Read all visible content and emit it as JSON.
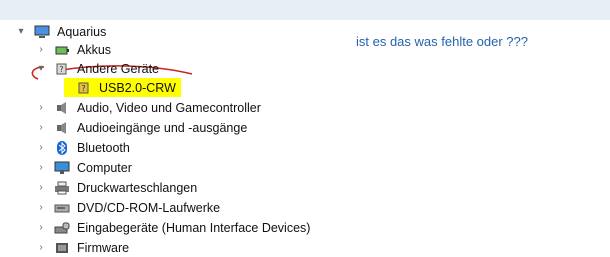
{
  "question": "ist es das was fehlte oder ???",
  "tree": {
    "root": "Aquarius",
    "items": [
      {
        "label": "Akkus",
        "icon": "battery-icon",
        "expanded": false
      },
      {
        "label": "Andere Geräte",
        "icon": "unknown-device-icon",
        "expanded": true
      },
      {
        "label": "USB2.0-CRW",
        "icon": "warning-device-icon",
        "child": true,
        "highlight": true
      },
      {
        "label": "Audio, Video und Gamecontroller",
        "icon": "speaker-icon",
        "expanded": false
      },
      {
        "label": "Audioeingänge und -ausgänge",
        "icon": "speaker-icon",
        "expanded": false
      },
      {
        "label": "Bluetooth",
        "icon": "bluetooth-icon",
        "expanded": false
      },
      {
        "label": "Computer",
        "icon": "monitor-icon",
        "expanded": false
      },
      {
        "label": "Druckwarteschlangen",
        "icon": "printer-icon",
        "expanded": false
      },
      {
        "label": "DVD/CD-ROM-Laufwerke",
        "icon": "disc-drive-icon",
        "expanded": false
      },
      {
        "label": "Eingabegeräte (Human Interface Devices)",
        "icon": "hid-icon",
        "expanded": false
      },
      {
        "label": "Firmware",
        "icon": "firmware-icon",
        "expanded": false
      }
    ]
  },
  "colors": {
    "highlight": "#ffff00",
    "annotation": "#cc2222",
    "question": "#2563ad",
    "bluetooth": "#1565d8"
  }
}
